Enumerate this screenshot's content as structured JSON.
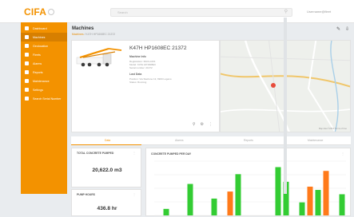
{
  "brand": {
    "name": "CIFA",
    "color": "#f39200"
  },
  "search": {
    "placeholder": "Search",
    "icon": "search-icon"
  },
  "user": {
    "name": "Username@fleet"
  },
  "sidebar": {
    "items": [
      {
        "label": "Dashboard",
        "icon": "dashboard-icon",
        "active": false
      },
      {
        "label": "Machines",
        "icon": "truck-icon",
        "active": true
      },
      {
        "label": "Geolocation",
        "icon": "pin-icon",
        "active": false
      },
      {
        "label": "Fleets",
        "icon": "folder-icon",
        "active": false
      },
      {
        "label": "Alarms",
        "icon": "bell-icon",
        "active": false
      },
      {
        "label": "Reports",
        "icon": "alert-icon",
        "active": false
      },
      {
        "label": "Maintenance",
        "icon": "wrench-icon",
        "active": false
      },
      {
        "label": "Settings",
        "icon": "gear-icon",
        "active": false
      },
      {
        "label": "Search Serial Number",
        "icon": "search-icon",
        "active": false
      }
    ]
  },
  "page": {
    "title": "Machines",
    "breadcrumb_link": "Machines",
    "breadcrumb_rest": "/ K47H HP1608EC 21372"
  },
  "machine": {
    "code": "K47H HP1608EC 21372",
    "section1": "Machine Info",
    "line1": "Registration: MACH-001",
    "line2": "Model: K47H HP1608EC",
    "line3": "Serial number: 21372",
    "section2": "Last Data",
    "line4": "Position: Via Stazione 13, 6900 Lugano",
    "line5": "Status: Running"
  },
  "map": {
    "footer": "Map data ©2019  Terms of Use"
  },
  "tabs": [
    {
      "label": "Data",
      "active": true
    },
    {
      "label": "Alarms",
      "active": false
    },
    {
      "label": "Reports",
      "active": false
    },
    {
      "label": "Maintenance",
      "active": false
    }
  ],
  "kpis": [
    {
      "label": "TOTAL CONCRETE PUMPED",
      "value": "20,622.0 m3"
    },
    {
      "label": "PUMP HOURS",
      "value": "436.8 hr"
    }
  ],
  "chart_data": {
    "type": "bar",
    "title": "CONCRETE PUMPED PER DAY",
    "series": [
      {
        "color": "#33cc33",
        "values": [
          0,
          1.2,
          0,
          0,
          5.8,
          0,
          0,
          3.1,
          0,
          0,
          7.6,
          0,
          0,
          0,
          0,
          8.9,
          6.2,
          0,
          2.4,
          0,
          4.7,
          0,
          0,
          3.9
        ]
      },
      {
        "color": "#ff7a1a",
        "values": [
          0,
          0,
          0,
          0,
          0,
          0,
          0,
          0,
          0,
          4.4,
          0,
          0,
          0,
          0,
          0,
          0,
          0,
          0,
          0,
          5.3,
          0,
          8.2,
          0,
          0
        ]
      }
    ],
    "ylim": [
      0,
      10
    ],
    "grid": true
  }
}
